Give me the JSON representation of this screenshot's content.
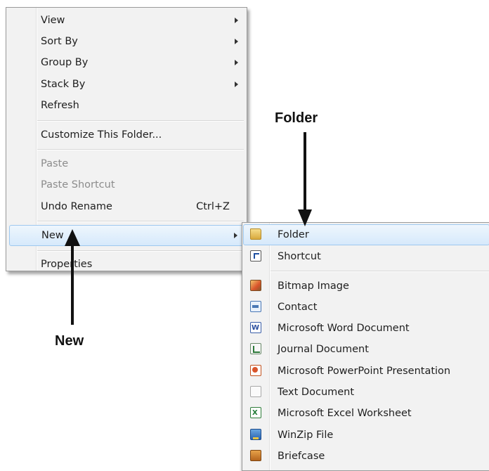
{
  "context_menu": {
    "items": [
      {
        "label": "View",
        "submenu": true
      },
      {
        "label": "Sort By",
        "submenu": true
      },
      {
        "label": "Group By",
        "submenu": true
      },
      {
        "label": "Stack By",
        "submenu": true
      },
      {
        "label": "Refresh"
      },
      {
        "label": "Customize This Folder..."
      },
      {
        "label": "Paste",
        "disabled": true
      },
      {
        "label": "Paste Shortcut",
        "disabled": true
      },
      {
        "label": "Undo Rename",
        "shortcut": "Ctrl+Z"
      },
      {
        "label": "New",
        "submenu": true,
        "highlighted": true
      },
      {
        "label": "Properties"
      }
    ]
  },
  "new_submenu": {
    "items": [
      {
        "label": "Folder",
        "icon": "folder-icon",
        "highlighted": true
      },
      {
        "label": "Shortcut",
        "icon": "shortcut-icon"
      },
      {
        "label": "Bitmap Image",
        "icon": "bitmap-image-icon"
      },
      {
        "label": "Contact",
        "icon": "contact-icon"
      },
      {
        "label": "Microsoft Word Document",
        "icon": "word-document-icon"
      },
      {
        "label": "Journal Document",
        "icon": "journal-document-icon"
      },
      {
        "label": "Microsoft PowerPoint Presentation",
        "icon": "powerpoint-presentation-icon"
      },
      {
        "label": "Text Document",
        "icon": "text-document-icon"
      },
      {
        "label": "Microsoft Excel Worksheet",
        "icon": "excel-worksheet-icon"
      },
      {
        "label": "WinZip File",
        "icon": "winzip-file-icon"
      },
      {
        "label": "Briefcase",
        "icon": "briefcase-icon"
      }
    ]
  },
  "annotations": {
    "folder_label": "Folder",
    "new_label": "New"
  },
  "colors": {
    "menu_background": "#f2f2f2",
    "highlight_background": "#d6e9fb",
    "highlight_border": "#9ec8ef",
    "disabled_text": "#8c8c8c",
    "annotation_text": "#111111"
  }
}
